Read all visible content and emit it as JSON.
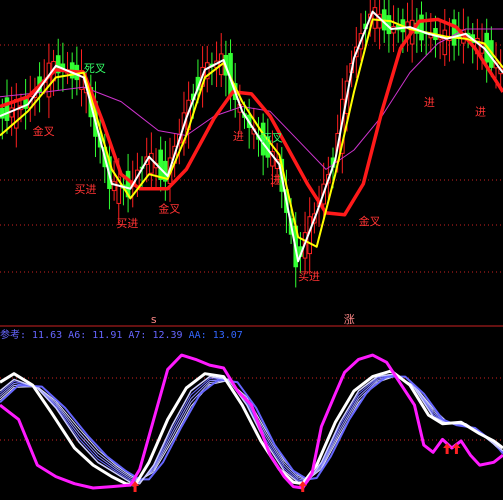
{
  "colors": {
    "background": "#000000",
    "up_candle": "#ff2020",
    "down_candle": "#33ff33",
    "ma_white": "#ffffff",
    "ma_yellow": "#ffff00",
    "ma_red": "#ff1a1a",
    "ma_magenta": "#cc33cc",
    "osc_magenta": "#ff1aff",
    "osc_blue": "#6666ff",
    "osc_white": "#ffffff",
    "gridline": "#cc2222",
    "signal_red": "#ff3333",
    "signal_green": "#33ff66",
    "indicator_text": "#6666ff"
  },
  "top_panel": {
    "signals": [
      {
        "text": "死叉",
        "color": "green",
        "x": 18,
        "y": 1.12
      },
      {
        "text": "金叉",
        "color": "red",
        "x": 7,
        "y": 1.055
      },
      {
        "text": "买进",
        "color": "red",
        "x": 16,
        "y": 0.995
      },
      {
        "text": "买进",
        "color": "red",
        "x": 25,
        "y": 0.96
      },
      {
        "text": "金叉",
        "color": "red",
        "x": 34,
        "y": 0.975
      },
      {
        "text": "进",
        "color": "red",
        "x": 50,
        "y": 1.05
      },
      {
        "text": "死叉",
        "color": "green",
        "x": 56,
        "y": 1.048
      },
      {
        "text": "进",
        "color": "red",
        "x": 58,
        "y": 1.005
      },
      {
        "text": "买进",
        "color": "red",
        "x": 64,
        "y": 0.905
      },
      {
        "text": "金叉",
        "color": "red",
        "x": 77,
        "y": 0.962
      },
      {
        "text": "进",
        "color": "red",
        "x": 91,
        "y": 1.085
      },
      {
        "text": "进",
        "color": "red",
        "x": 102,
        "y": 1.075
      }
    ],
    "markers": [
      {
        "text": "s",
        "x": 33
      },
      {
        "text": "涨",
        "x": 75
      }
    ]
  },
  "bottom_panel": {
    "legend": [
      {
        "label": "参考:",
        "value": "11.63",
        "color": "#6666ff"
      },
      {
        "label": "A6:",
        "value": "11.91",
        "color": "#6666ff"
      },
      {
        "label": "A7:",
        "value": "12.39",
        "color": "#6666ff"
      },
      {
        "label": "AA:",
        "value": "13.07",
        "color": "#3366ff"
      }
    ],
    "arrows_x": [
      29,
      65,
      96,
      98
    ]
  },
  "chart_data": [
    {
      "type": "line",
      "series": [
        {
          "values": [
            {
              "x": 0,
              "y": 1.06
            },
            {
              "x": 6,
              "y": 1.072
            },
            {
              "x": 12,
              "y": 1.112
            },
            {
              "x": 18,
              "y": 1.1
            },
            {
              "x": 24,
              "y": 0.99
            },
            {
              "x": 28,
              "y": 0.985
            },
            {
              "x": 32,
              "y": 1.018
            },
            {
              "x": 36,
              "y": 0.998
            },
            {
              "x": 40,
              "y": 1.058
            },
            {
              "x": 44,
              "y": 1.108
            },
            {
              "x": 48,
              "y": 1.118
            },
            {
              "x": 52,
              "y": 1.065
            },
            {
              "x": 56,
              "y": 1.035
            },
            {
              "x": 60,
              "y": 1.01
            },
            {
              "x": 64,
              "y": 0.91
            },
            {
              "x": 68,
              "y": 0.96
            },
            {
              "x": 72,
              "y": 1.015
            },
            {
              "x": 76,
              "y": 1.12
            },
            {
              "x": 80,
              "y": 1.168
            },
            {
              "x": 84,
              "y": 1.15
            },
            {
              "x": 88,
              "y": 1.152
            },
            {
              "x": 92,
              "y": 1.145
            },
            {
              "x": 96,
              "y": 1.14
            },
            {
              "x": 100,
              "y": 1.145
            },
            {
              "x": 104,
              "y": 1.13
            },
            {
              "x": 108,
              "y": 1.105
            }
          ]
        },
        {
          "values": [
            {
              "x": 0,
              "y": 1.04
            },
            {
              "x": 6,
              "y": 1.065
            },
            {
              "x": 12,
              "y": 1.1
            },
            {
              "x": 18,
              "y": 1.105
            },
            {
              "x": 24,
              "y": 1.005
            },
            {
              "x": 28,
              "y": 0.975
            },
            {
              "x": 32,
              "y": 1.0
            },
            {
              "x": 36,
              "y": 0.995
            },
            {
              "x": 40,
              "y": 1.04
            },
            {
              "x": 44,
              "y": 1.1
            },
            {
              "x": 48,
              "y": 1.115
            },
            {
              "x": 52,
              "y": 1.075
            },
            {
              "x": 56,
              "y": 1.045
            },
            {
              "x": 60,
              "y": 1.02
            },
            {
              "x": 64,
              "y": 0.935
            },
            {
              "x": 68,
              "y": 0.925
            },
            {
              "x": 72,
              "y": 1.0
            },
            {
              "x": 76,
              "y": 1.085
            },
            {
              "x": 80,
              "y": 1.16
            },
            {
              "x": 84,
              "y": 1.158
            },
            {
              "x": 88,
              "y": 1.15
            },
            {
              "x": 92,
              "y": 1.146
            },
            {
              "x": 96,
              "y": 1.142
            },
            {
              "x": 100,
              "y": 1.14
            },
            {
              "x": 104,
              "y": 1.135
            },
            {
              "x": 108,
              "y": 1.11
            }
          ]
        },
        {
          "values": [
            {
              "x": 0,
              "y": 1.07
            },
            {
              "x": 6,
              "y": 1.08
            },
            {
              "x": 12,
              "y": 1.108
            },
            {
              "x": 18,
              "y": 1.105
            },
            {
              "x": 22,
              "y": 1.055
            },
            {
              "x": 26,
              "y": 1.0
            },
            {
              "x": 30,
              "y": 0.985
            },
            {
              "x": 36,
              "y": 0.985
            },
            {
              "x": 40,
              "y": 1.005
            },
            {
              "x": 46,
              "y": 1.058
            },
            {
              "x": 50,
              "y": 1.085
            },
            {
              "x": 54,
              "y": 1.083
            },
            {
              "x": 58,
              "y": 1.06
            },
            {
              "x": 62,
              "y": 1.025
            },
            {
              "x": 66,
              "y": 0.99
            },
            {
              "x": 70,
              "y": 0.96
            },
            {
              "x": 74,
              "y": 0.958
            },
            {
              "x": 78,
              "y": 0.99
            },
            {
              "x": 82,
              "y": 1.065
            },
            {
              "x": 86,
              "y": 1.13
            },
            {
              "x": 90,
              "y": 1.158
            },
            {
              "x": 94,
              "y": 1.16
            },
            {
              "x": 98,
              "y": 1.152
            },
            {
              "x": 102,
              "y": 1.13
            },
            {
              "x": 106,
              "y": 1.1
            },
            {
              "x": 108,
              "y": 1.085
            }
          ]
        },
        {
          "values": [
            {
              "x": 0,
              "y": 1.08
            },
            {
              "x": 10,
              "y": 1.085
            },
            {
              "x": 18,
              "y": 1.09
            },
            {
              "x": 26,
              "y": 1.075
            },
            {
              "x": 34,
              "y": 1.045
            },
            {
              "x": 40,
              "y": 1.04
            },
            {
              "x": 46,
              "y": 1.06
            },
            {
              "x": 52,
              "y": 1.07
            },
            {
              "x": 58,
              "y": 1.065
            },
            {
              "x": 64,
              "y": 1.035
            },
            {
              "x": 70,
              "y": 1.005
            },
            {
              "x": 76,
              "y": 1.025
            },
            {
              "x": 82,
              "y": 1.06
            },
            {
              "x": 88,
              "y": 1.105
            },
            {
              "x": 94,
              "y": 1.135
            },
            {
              "x": 100,
              "y": 1.15
            },
            {
              "x": 108,
              "y": 1.15
            }
          ]
        }
      ]
    },
    {
      "type": "line",
      "legend": [
        "参考",
        "A6",
        "A7",
        "AA"
      ],
      "series": [
        {
          "values": [
            {
              "x": 0,
              "y": 60
            },
            {
              "x": 4,
              "y": 50
            },
            {
              "x": 8,
              "y": 18
            },
            {
              "x": 12,
              "y": 10
            },
            {
              "x": 16,
              "y": 5
            },
            {
              "x": 20,
              "y": 2
            },
            {
              "x": 24,
              "y": 3
            },
            {
              "x": 28,
              "y": 4
            },
            {
              "x": 30,
              "y": 15
            },
            {
              "x": 33,
              "y": 50
            },
            {
              "x": 36,
              "y": 85
            },
            {
              "x": 39,
              "y": 95
            },
            {
              "x": 42,
              "y": 92
            },
            {
              "x": 45,
              "y": 88
            },
            {
              "x": 48,
              "y": 86
            },
            {
              "x": 51,
              "y": 70
            },
            {
              "x": 54,
              "y": 60
            },
            {
              "x": 58,
              "y": 25
            },
            {
              "x": 61,
              "y": 10
            },
            {
              "x": 63,
              "y": 3
            },
            {
              "x": 65,
              "y": 2
            },
            {
              "x": 67,
              "y": 12
            },
            {
              "x": 69,
              "y": 45
            },
            {
              "x": 72,
              "y": 68
            },
            {
              "x": 74,
              "y": 83
            },
            {
              "x": 77,
              "y": 92
            },
            {
              "x": 80,
              "y": 95
            },
            {
              "x": 83,
              "y": 90
            },
            {
              "x": 86,
              "y": 75
            },
            {
              "x": 89,
              "y": 60
            },
            {
              "x": 91,
              "y": 32
            },
            {
              "x": 93,
              "y": 27
            },
            {
              "x": 95,
              "y": 36
            },
            {
              "x": 97,
              "y": 30
            },
            {
              "x": 99,
              "y": 35
            },
            {
              "x": 101,
              "y": 25
            },
            {
              "x": 103,
              "y": 18
            },
            {
              "x": 106,
              "y": 20
            },
            {
              "x": 108,
              "y": 25
            }
          ]
        },
        {
          "values": [
            {
              "x": 0,
              "y": 76
            },
            {
              "x": 3,
              "y": 82
            },
            {
              "x": 7,
              "y": 74
            },
            {
              "x": 11,
              "y": 55
            },
            {
              "x": 16,
              "y": 30
            },
            {
              "x": 20,
              "y": 18
            },
            {
              "x": 24,
              "y": 10
            },
            {
              "x": 27,
              "y": 5
            },
            {
              "x": 29,
              "y": 4
            },
            {
              "x": 32,
              "y": 20
            },
            {
              "x": 36,
              "y": 50
            },
            {
              "x": 40,
              "y": 72
            },
            {
              "x": 44,
              "y": 82
            },
            {
              "x": 48,
              "y": 80
            },
            {
              "x": 52,
              "y": 60
            },
            {
              "x": 56,
              "y": 35
            },
            {
              "x": 60,
              "y": 15
            },
            {
              "x": 63,
              "y": 6
            },
            {
              "x": 65,
              "y": 5
            },
            {
              "x": 68,
              "y": 18
            },
            {
              "x": 72,
              "y": 48
            },
            {
              "x": 76,
              "y": 70
            },
            {
              "x": 80,
              "y": 80
            },
            {
              "x": 84,
              "y": 84
            },
            {
              "x": 88,
              "y": 74
            },
            {
              "x": 92,
              "y": 53
            },
            {
              "x": 95,
              "y": 47
            },
            {
              "x": 99,
              "y": 48
            },
            {
              "x": 103,
              "y": 40
            },
            {
              "x": 106,
              "y": 35
            },
            {
              "x": 108,
              "y": 30
            }
          ]
        },
        {
          "values": [
            {
              "x": 0,
              "y": 70
            },
            {
              "x": 3,
              "y": 78
            },
            {
              "x": 8,
              "y": 72
            },
            {
              "x": 12,
              "y": 58
            },
            {
              "x": 17,
              "y": 34
            },
            {
              "x": 21,
              "y": 20
            },
            {
              "x": 25,
              "y": 12
            },
            {
              "x": 28,
              "y": 6
            },
            {
              "x": 30,
              "y": 5
            },
            {
              "x": 33,
              "y": 18
            },
            {
              "x": 37,
              "y": 46
            },
            {
              "x": 41,
              "y": 70
            },
            {
              "x": 45,
              "y": 80
            },
            {
              "x": 49,
              "y": 78
            },
            {
              "x": 53,
              "y": 60
            },
            {
              "x": 57,
              "y": 34
            },
            {
              "x": 61,
              "y": 14
            },
            {
              "x": 64,
              "y": 6
            },
            {
              "x": 66,
              "y": 6
            },
            {
              "x": 69,
              "y": 20
            },
            {
              "x": 73,
              "y": 48
            },
            {
              "x": 77,
              "y": 70
            },
            {
              "x": 81,
              "y": 80
            },
            {
              "x": 85,
              "y": 82
            },
            {
              "x": 89,
              "y": 72
            },
            {
              "x": 93,
              "y": 52
            },
            {
              "x": 96,
              "y": 47
            },
            {
              "x": 100,
              "y": 47
            },
            {
              "x": 104,
              "y": 38
            },
            {
              "x": 108,
              "y": 28
            }
          ]
        },
        {
          "values": [
            {
              "x": 0,
              "y": 62
            },
            {
              "x": 4,
              "y": 74
            },
            {
              "x": 9,
              "y": 73
            },
            {
              "x": 14,
              "y": 58
            },
            {
              "x": 19,
              "y": 38
            },
            {
              "x": 23,
              "y": 24
            },
            {
              "x": 27,
              "y": 14
            },
            {
              "x": 30,
              "y": 8
            },
            {
              "x": 32,
              "y": 8
            },
            {
              "x": 35,
              "y": 20
            },
            {
              "x": 39,
              "y": 45
            },
            {
              "x": 43,
              "y": 68
            },
            {
              "x": 47,
              "y": 78
            },
            {
              "x": 51,
              "y": 76
            },
            {
              "x": 55,
              "y": 58
            },
            {
              "x": 59,
              "y": 32
            },
            {
              "x": 63,
              "y": 14
            },
            {
              "x": 66,
              "y": 8
            },
            {
              "x": 68,
              "y": 9
            },
            {
              "x": 71,
              "y": 24
            },
            {
              "x": 75,
              "y": 50
            },
            {
              "x": 79,
              "y": 70
            },
            {
              "x": 83,
              "y": 80
            },
            {
              "x": 87,
              "y": 80
            },
            {
              "x": 91,
              "y": 68
            },
            {
              "x": 95,
              "y": 50
            },
            {
              "x": 98,
              "y": 46
            },
            {
              "x": 102,
              "y": 44
            },
            {
              "x": 106,
              "y": 34
            },
            {
              "x": 108,
              "y": 26
            }
          ]
        }
      ]
    }
  ]
}
